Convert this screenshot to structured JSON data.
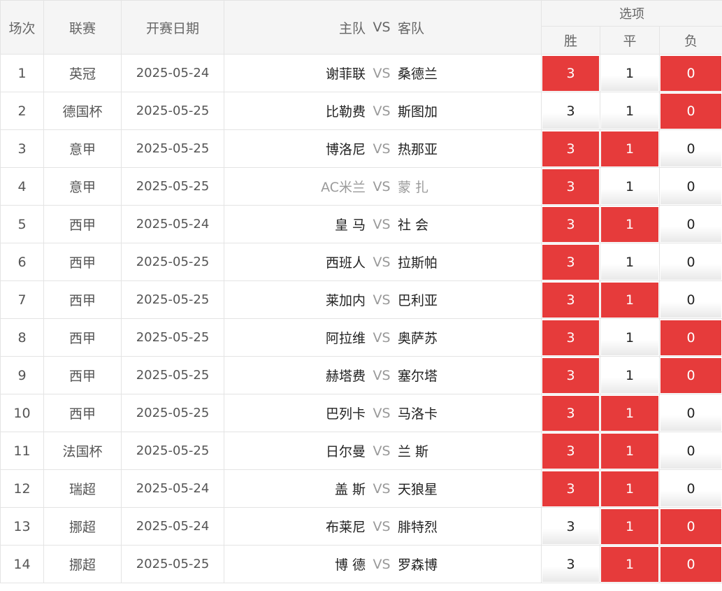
{
  "headers": {
    "round": "场次",
    "league": "联赛",
    "date": "开赛日期",
    "home": "主队",
    "vs": "VS",
    "away": "客队",
    "options": "选项",
    "win": "胜",
    "draw": "平",
    "lose": "负"
  },
  "option_labels": {
    "win": "3",
    "draw": "1",
    "lose": "0"
  },
  "colors": {
    "selected": "#e63b3b",
    "muted_team": "#9a9a9a"
  },
  "rows": [
    {
      "no": "1",
      "league": "英冠",
      "date": "2025-05-24",
      "home": "谢菲联",
      "vs": "VS",
      "away": "桑德兰",
      "sel": [
        true,
        false,
        true
      ]
    },
    {
      "no": "2",
      "league": "德国杯",
      "date": "2025-05-25",
      "home": "比勒费",
      "vs": "VS",
      "away": "斯图加",
      "sel": [
        false,
        false,
        true
      ]
    },
    {
      "no": "3",
      "league": "意甲",
      "date": "2025-05-25",
      "home": "博洛尼",
      "vs": "VS",
      "away": "热那亚",
      "sel": [
        true,
        true,
        false
      ]
    },
    {
      "no": "4",
      "league": "意甲",
      "date": "2025-05-25",
      "home": "AC米兰",
      "vs": "VS",
      "away": "蒙 扎",
      "sel": [
        true,
        false,
        false
      ],
      "muted": true
    },
    {
      "no": "5",
      "league": "西甲",
      "date": "2025-05-24",
      "home": "皇 马",
      "vs": "VS",
      "away": "社 会",
      "sel": [
        true,
        true,
        false
      ]
    },
    {
      "no": "6",
      "league": "西甲",
      "date": "2025-05-25",
      "home": "西班人",
      "vs": "VS",
      "away": "拉斯帕",
      "sel": [
        true,
        false,
        false
      ]
    },
    {
      "no": "7",
      "league": "西甲",
      "date": "2025-05-25",
      "home": "莱加内",
      "vs": "VS",
      "away": "巴利亚",
      "sel": [
        true,
        true,
        false
      ]
    },
    {
      "no": "8",
      "league": "西甲",
      "date": "2025-05-25",
      "home": "阿拉维",
      "vs": "VS",
      "away": "奥萨苏",
      "sel": [
        true,
        false,
        true
      ]
    },
    {
      "no": "9",
      "league": "西甲",
      "date": "2025-05-25",
      "home": "赫塔费",
      "vs": "VS",
      "away": "塞尔塔",
      "sel": [
        true,
        false,
        true
      ]
    },
    {
      "no": "10",
      "league": "西甲",
      "date": "2025-05-25",
      "home": "巴列卡",
      "vs": "VS",
      "away": "马洛卡",
      "sel": [
        true,
        true,
        false
      ]
    },
    {
      "no": "11",
      "league": "法国杯",
      "date": "2025-05-25",
      "home": "日尔曼",
      "vs": "VS",
      "away": "兰 斯",
      "sel": [
        true,
        true,
        false
      ]
    },
    {
      "no": "12",
      "league": "瑞超",
      "date": "2025-05-24",
      "home": "盖 斯",
      "vs": "VS",
      "away": "天狼星",
      "sel": [
        true,
        true,
        false
      ]
    },
    {
      "no": "13",
      "league": "挪超",
      "date": "2025-05-24",
      "home": "布莱尼",
      "vs": "VS",
      "away": "腓特烈",
      "sel": [
        false,
        true,
        true
      ]
    },
    {
      "no": "14",
      "league": "挪超",
      "date": "2025-05-25",
      "home": "博 德",
      "vs": "VS",
      "away": "罗森博",
      "sel": [
        false,
        true,
        true
      ]
    }
  ]
}
